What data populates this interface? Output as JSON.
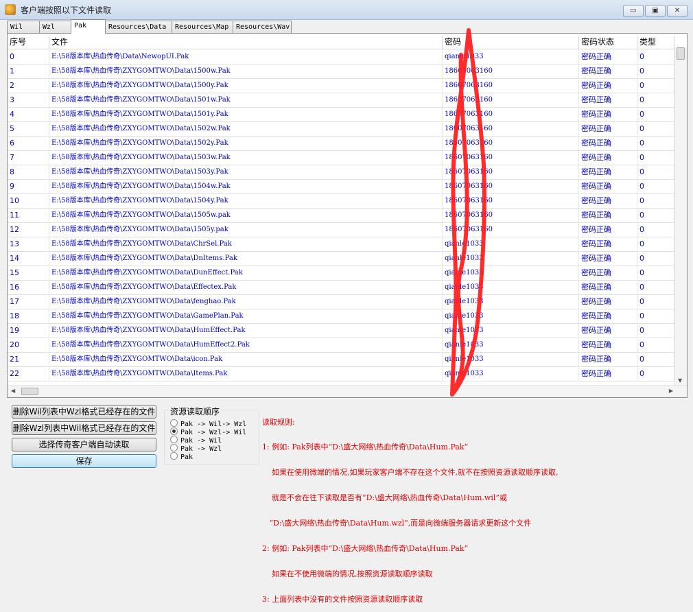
{
  "window": {
    "title": "客户端按照以下文件读取",
    "minimize": "▭",
    "maximize": "▣",
    "close": "✕"
  },
  "tabs": [
    "Wil",
    "Wzl",
    "Pak",
    "Resources\\Data",
    "Resources\\Map",
    "Resources\\Wav"
  ],
  "active_tab": "Pak",
  "table": {
    "headers": [
      "序号",
      "文件",
      "密码",
      "密码状态",
      "类型"
    ],
    "rows": [
      [
        "0",
        "E:\\58版本库\\热血传奇\\Data\\NewopUI.Pak",
        "qianle1033",
        "密码正确",
        "0"
      ],
      [
        "1",
        "E:\\58版本库\\热血传奇\\ZXYGOMTWO\\Data\\1500w.Pak",
        "18607063160",
        "密码正确",
        "0"
      ],
      [
        "2",
        "E:\\58版本库\\热血传奇\\ZXYGOMTWO\\Data\\1500y.Pak",
        "18607063160",
        "密码正确",
        "0"
      ],
      [
        "3",
        "E:\\58版本库\\热血传奇\\ZXYGOMTWO\\Data\\1501w.Pak",
        "18607063160",
        "密码正确",
        "0"
      ],
      [
        "4",
        "E:\\58版本库\\热血传奇\\ZXYGOMTWO\\Data\\1501y.Pak",
        "18607063160",
        "密码正确",
        "0"
      ],
      [
        "5",
        "E:\\58版本库\\热血传奇\\ZXYGOMTWO\\Data\\1502w.Pak",
        "18607063160",
        "密码正确",
        "0"
      ],
      [
        "6",
        "E:\\58版本库\\热血传奇\\ZXYGOMTWO\\Data\\1502y.Pak",
        "18607063160",
        "密码正确",
        "0"
      ],
      [
        "7",
        "E:\\58版本库\\热血传奇\\ZXYGOMTWO\\Data\\1503w.Pak",
        "18607063160",
        "密码正确",
        "0"
      ],
      [
        "8",
        "E:\\58版本库\\热血传奇\\ZXYGOMTWO\\Data\\1503y.Pak",
        "18607063160",
        "密码正确",
        "0"
      ],
      [
        "9",
        "E:\\58版本库\\热血传奇\\ZXYGOMTWO\\Data\\1504w.Pak",
        "18607063160",
        "密码正确",
        "0"
      ],
      [
        "10",
        "E:\\58版本库\\热血传奇\\ZXYGOMTWO\\Data\\1504y.Pak",
        "18607063160",
        "密码正确",
        "0"
      ],
      [
        "11",
        "E:\\58版本库\\热血传奇\\ZXYGOMTWO\\Data\\1505w.pak",
        "18607063160",
        "密码正确",
        "0"
      ],
      [
        "12",
        "E:\\58版本库\\热血传奇\\ZXYGOMTWO\\Data\\1505y.pak",
        "18607063160",
        "密码正确",
        "0"
      ],
      [
        "13",
        "E:\\58版本库\\热血传奇\\ZXYGOMTWO\\Data\\ChrSel.Pak",
        "qianle1033",
        "密码正确",
        "0"
      ],
      [
        "14",
        "E:\\58版本库\\热血传奇\\ZXYGOMTWO\\Data\\DnItems.Pak",
        "qianle1033",
        "密码正确",
        "0"
      ],
      [
        "15",
        "E:\\58版本库\\热血传奇\\ZXYGOMTWO\\Data\\DunEffect.Pak",
        "qianle1033",
        "密码正确",
        "0"
      ],
      [
        "16",
        "E:\\58版本库\\热血传奇\\ZXYGOMTWO\\Data\\Effectex.Pak",
        "qianle1033",
        "密码正确",
        "0"
      ],
      [
        "17",
        "E:\\58版本库\\热血传奇\\ZXYGOMTWO\\Data\\fenghao.Pak",
        "qianle1033",
        "密码正确",
        "0"
      ],
      [
        "18",
        "E:\\58版本库\\热血传奇\\ZXYGOMTWO\\Data\\GamePlan.Pak",
        "qianle1033",
        "密码正确",
        "0"
      ],
      [
        "19",
        "E:\\58版本库\\热血传奇\\ZXYGOMTWO\\Data\\HumEffect.Pak",
        "qianle1033",
        "密码正确",
        "0"
      ],
      [
        "20",
        "E:\\58版本库\\热血传奇\\ZXYGOMTWO\\Data\\HumEffect2.Pak",
        "qianle1033",
        "密码正确",
        "0"
      ],
      [
        "21",
        "E:\\58版本库\\热血传奇\\ZXYGOMTWO\\Data\\icon.Pak",
        "qianle1033",
        "密码正确",
        "0"
      ],
      [
        "22",
        "E:\\58版本库\\热血传奇\\ZXYGOMTWO\\Data\\Items.Pak",
        "qianle1033",
        "密码正确",
        "0"
      ]
    ]
  },
  "buttons": {
    "delete_wil": "删除Wil列表中Wzl格式已经存在的文件",
    "delete_wzl": "删除Wzl列表中Wil格式已经存在的文件",
    "auto_read": "选择传奇客户端自动读取",
    "save": "保存"
  },
  "read_order": {
    "title": "资源读取顺序",
    "options": [
      "Pak -> Wil-> Wzl",
      "Pak -> Wzl-> Wil",
      "Pak -> Wil",
      "Pak -> Wzl",
      "Pak"
    ],
    "selected": 1
  },
  "rules": [
    "读取规则:",
    "1: 例如: Pak列表中“D:\\盛大网络\\热血传奇\\Data\\Hum.Pak”",
    "    如果在使用微端的情况,如果玩家客户端不存在这个文件,就不在按照资源读取顺序读取,",
    "    就是不会在往下读取是否有“D:\\盛大网络\\热血传奇\\Data\\Hum.wil”或",
    "   “D:\\盛大网络\\热血传奇\\Data\\Hum.wzl”,而是向微端服务器请求更新这个文件",
    "2: 例如: Pak列表中“D:\\盛大网络\\热血传奇\\Data\\Hum.Pak”",
    "    如果在不使用微端的情况,按照资源读取顺序读取",
    "3: 上面列表中没有的文件按照资源读取顺序读取"
  ],
  "colors": {
    "link_text": "#0000c0",
    "rules_text": "#e00000",
    "annotation": "#ff1a1a"
  }
}
